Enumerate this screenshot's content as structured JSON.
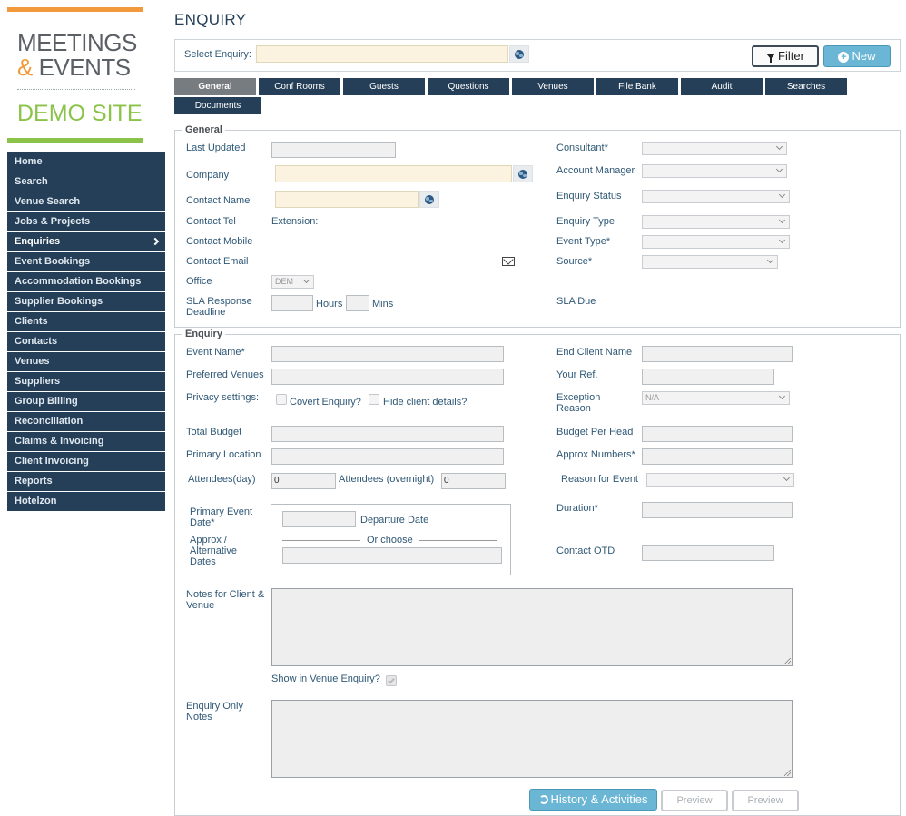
{
  "logo": {
    "line1": "MEETINGS",
    "amp": "&",
    "line2": " EVENTS",
    "demo": "DEMO SITE"
  },
  "sidebar": {
    "items": [
      {
        "label": "Home"
      },
      {
        "label": "Search"
      },
      {
        "label": "Venue Search"
      },
      {
        "label": "Jobs & Projects"
      },
      {
        "label": "Enquiries"
      },
      {
        "label": "Event Bookings"
      },
      {
        "label": "Accommodation Bookings"
      },
      {
        "label": "Supplier Bookings"
      },
      {
        "label": "Clients"
      },
      {
        "label": "Contacts"
      },
      {
        "label": "Venues"
      },
      {
        "label": "Suppliers"
      },
      {
        "label": "Group Billing"
      },
      {
        "label": "Reconciliation"
      },
      {
        "label": "Claims & Invoicing"
      },
      {
        "label": "Client Invoicing"
      },
      {
        "label": "Reports"
      },
      {
        "label": "Hotelzon"
      }
    ]
  },
  "header": {
    "title": "ENQUIRY",
    "select_label": "Select Enquiry:",
    "filter_label": "Filter",
    "new_label": "New"
  },
  "tabs": [
    {
      "label": "General"
    },
    {
      "label": "Conf Rooms"
    },
    {
      "label": "Guests"
    },
    {
      "label": "Questions"
    },
    {
      "label": "Venues"
    },
    {
      "label": "File Bank"
    },
    {
      "label": "Audit"
    },
    {
      "label": "Searches"
    },
    {
      "label": "Documents"
    }
  ],
  "general": {
    "legend": "General",
    "last_updated": "Last Updated",
    "company": "Company",
    "contact_name": "Contact Name",
    "contact_tel": "Contact Tel",
    "extension": "Extension:",
    "contact_mobile": "Contact Mobile",
    "contact_email": "Contact Email",
    "office": "Office",
    "office_value": "DEM",
    "sla_response": "SLA Response Deadline",
    "hours": "Hours",
    "mins": "Mins",
    "consultant": "Consultant*",
    "account_manager": "Account Manager",
    "enquiry_status": "Enquiry Status",
    "enquiry_type": "Enquiry Type",
    "event_type": "Event Type*",
    "source": "Source*",
    "sla_due": "SLA Due"
  },
  "enquiry": {
    "legend": "Enquiry",
    "event_name": "Event Name*",
    "preferred_venues": "Preferred Venues",
    "privacy_settings": "Privacy settings:",
    "covert_enquiry": "Covert Enquiry?",
    "hide_client": "Hide client details?",
    "total_budget": "Total Budget",
    "primary_location": "Primary Location",
    "attendees_day": "Attendees(day)",
    "attendees_day_value": "0",
    "attendees_overnight": "Attendees (overnight)",
    "attendees_overnight_value": "0",
    "primary_event_date": "Primary Event Date*",
    "departure_date": "Departure Date",
    "or_choose": "Or choose",
    "approx_dates": "Approx / Alternative Dates",
    "end_client_name": "End Client Name",
    "your_ref": "Your Ref.",
    "exception_reason": "Exception Reason",
    "exception_value": "N/A",
    "budget_per_head": "Budget Per Head",
    "approx_numbers": "Approx Numbers*",
    "reason_for_event": "Reason for Event",
    "duration": "Duration*",
    "contact_otd": "Contact OTD",
    "notes_client_venue": "Notes for Client & Venue",
    "show_in_venue": "Show in Venue Enquiry?",
    "enquiry_only_notes": "Enquiry Only Notes"
  },
  "actions": {
    "history": "History & Activities",
    "preview1": "Preview",
    "preview2": "Preview"
  }
}
